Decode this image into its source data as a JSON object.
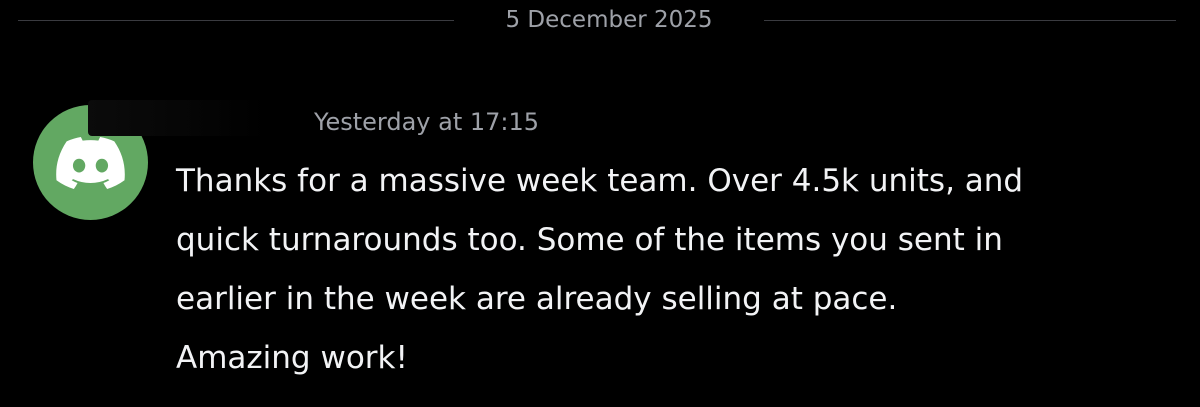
{
  "divider": {
    "date": "5 December 2025"
  },
  "message": {
    "author_name": "",
    "timestamp": "Yesterday at 17:15",
    "content": "Thanks for a massive week team. Over 4.5k units, and\nquick turnarounds too. Some of the items you sent in\nearlier in the week are already selling at pace.\nAmazing work!",
    "avatar": {
      "icon": "discord-logo-icon",
      "background_color": "#62a862"
    }
  },
  "theme": {
    "background": "#000000",
    "muted_text": "#9ea1a8",
    "text": "#f2f3f5",
    "divider_line": "#3a3b40"
  }
}
